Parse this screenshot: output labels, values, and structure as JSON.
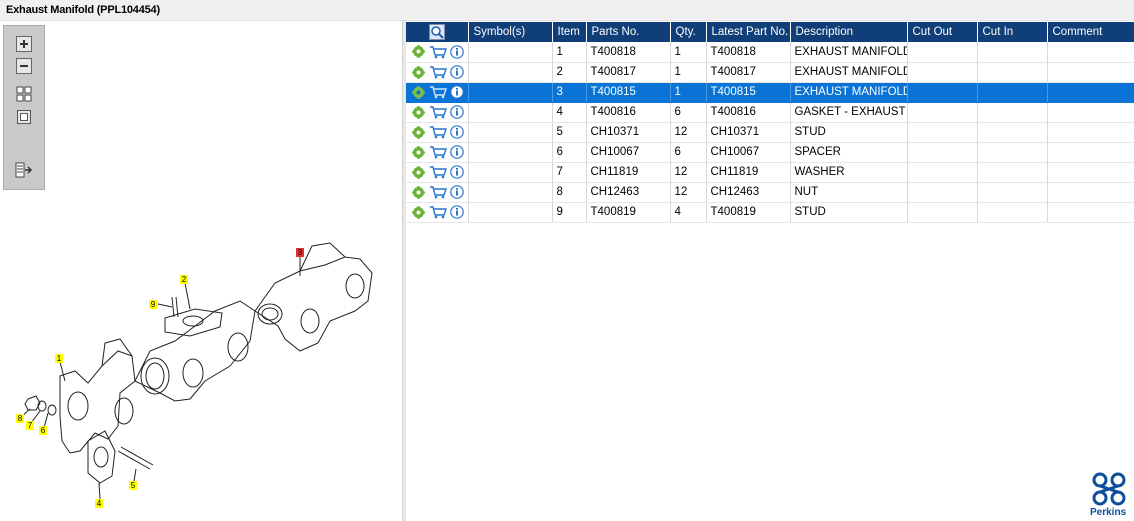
{
  "window": {
    "title": "Exhaust Manifold (PPL104454)"
  },
  "toolbar": {
    "buttons": [
      {
        "name": "zoom-in",
        "icon": "plus-icon"
      },
      {
        "name": "zoom-out",
        "icon": "minus-icon"
      },
      {
        "name": "fit-all",
        "icon": "grid-icon"
      },
      {
        "name": "fit-window",
        "icon": "square-icon"
      },
      {
        "name": "toggle-panel",
        "icon": "panel-arrow-icon"
      }
    ]
  },
  "diagram": {
    "callouts": [
      {
        "label": "1",
        "highlight": false
      },
      {
        "label": "2",
        "highlight": false
      },
      {
        "label": "3",
        "highlight": true
      },
      {
        "label": "4",
        "highlight": false
      },
      {
        "label": "5",
        "highlight": false
      },
      {
        "label": "6",
        "highlight": false
      },
      {
        "label": "7",
        "highlight": false
      },
      {
        "label": "8",
        "highlight": false
      },
      {
        "label": "9",
        "highlight": false
      }
    ],
    "callout_color": "#ffff00",
    "highlight_color": "#e03030"
  },
  "table": {
    "columns": [
      "",
      "Symbol(s)",
      "Item",
      "Parts No.",
      "Qty.",
      "Latest Part No.",
      "Description",
      "Cut Out",
      "Cut In",
      "Comment"
    ],
    "header_color": "#0f3e78",
    "selected_color": "#0a74d6",
    "rows": [
      {
        "symbols": "",
        "item": "1",
        "part_no": "T400818",
        "qty": "1",
        "latest_part_no": "T400818",
        "description": "EXHAUST MANIFOLD",
        "cut_out": "",
        "cut_in": "",
        "comment": "",
        "selected": false
      },
      {
        "symbols": "",
        "item": "2",
        "part_no": "T400817",
        "qty": "1",
        "latest_part_no": "T400817",
        "description": "EXHAUST MANIFOLD",
        "cut_out": "",
        "cut_in": "",
        "comment": "",
        "selected": false
      },
      {
        "symbols": "",
        "item": "3",
        "part_no": "T400815",
        "qty": "1",
        "latest_part_no": "T400815",
        "description": "EXHAUST MANIFOLD",
        "cut_out": "",
        "cut_in": "",
        "comment": "",
        "selected": true
      },
      {
        "symbols": "",
        "item": "4",
        "part_no": "T400816",
        "qty": "6",
        "latest_part_no": "T400816",
        "description": "GASKET - EXHAUST MA",
        "cut_out": "",
        "cut_in": "",
        "comment": "",
        "selected": false
      },
      {
        "symbols": "",
        "item": "5",
        "part_no": "CH10371",
        "qty": "12",
        "latest_part_no": "CH10371",
        "description": "STUD",
        "cut_out": "",
        "cut_in": "",
        "comment": "",
        "selected": false
      },
      {
        "symbols": "",
        "item": "6",
        "part_no": "CH10067",
        "qty": "6",
        "latest_part_no": "CH10067",
        "description": "SPACER",
        "cut_out": "",
        "cut_in": "",
        "comment": "",
        "selected": false
      },
      {
        "symbols": "",
        "item": "7",
        "part_no": "CH11819",
        "qty": "12",
        "latest_part_no": "CH11819",
        "description": "WASHER",
        "cut_out": "",
        "cut_in": "",
        "comment": "",
        "selected": false
      },
      {
        "symbols": "",
        "item": "8",
        "part_no": "CH12463",
        "qty": "12",
        "latest_part_no": "CH12463",
        "description": "NUT",
        "cut_out": "",
        "cut_in": "",
        "comment": "",
        "selected": false
      },
      {
        "symbols": "",
        "item": "9",
        "part_no": "T400819",
        "qty": "4",
        "latest_part_no": "T400819",
        "description": "STUD",
        "cut_out": "",
        "cut_in": "",
        "comment": "",
        "selected": false
      }
    ],
    "row_icons": [
      "gear-icon",
      "cart-icon",
      "info-icon"
    ]
  },
  "brand": {
    "name": "Perkins",
    "color": "#0d4f9c"
  }
}
